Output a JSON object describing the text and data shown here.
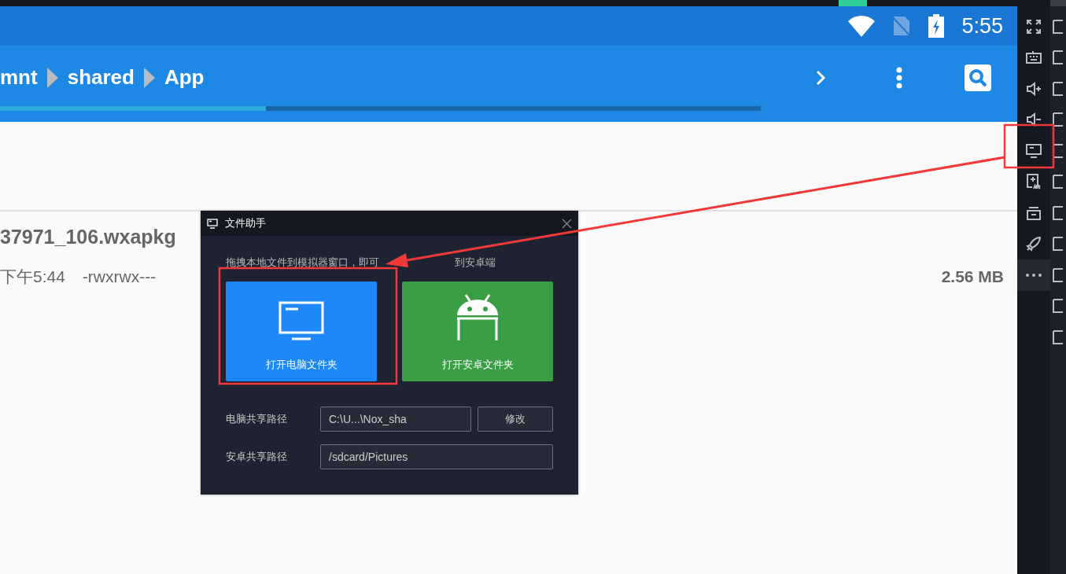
{
  "status_bar": {
    "time": "5:55"
  },
  "toolbar": {
    "breadcrumbs": [
      "mnt",
      "shared",
      "App"
    ],
    "progress": {
      "level": 0.35
    }
  },
  "file": {
    "name": "37971_106.wxapkg",
    "date": "下午5:44",
    "permissions": "-rwxrwx---",
    "size": "2.56 MB"
  },
  "dialog": {
    "title": "文件助手",
    "hint": [
      "拖拽本地文件到模拟器窗口，即可",
      "到安卓端"
    ],
    "actions": [
      {
        "kind": "pc",
        "label": "打开电脑文件夹"
      },
      {
        "kind": "android",
        "label": "打开安卓文件夹"
      }
    ],
    "fields": [
      {
        "label": "电脑共享路径",
        "value": "C:\\U...\\Nox_sha",
        "button": "修改"
      },
      {
        "label": "安卓共享路径",
        "value": "/sdcard/Pictures"
      }
    ]
  }
}
